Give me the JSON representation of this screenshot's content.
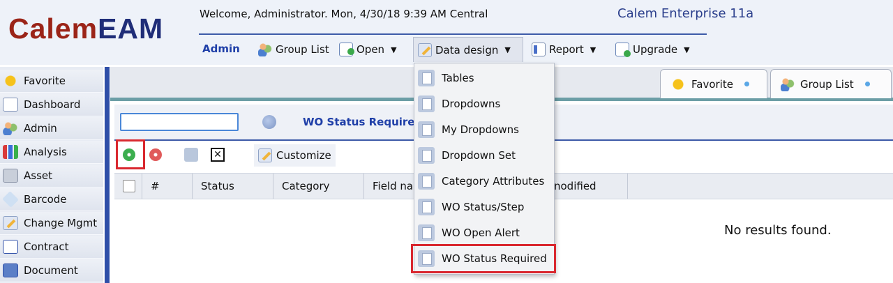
{
  "header": {
    "logo_part1": "Calem",
    "logo_part2": "EAM",
    "welcome": "Welcome, Administrator. Mon, 4/30/18 9:39 AM Central",
    "product": "Calem Enterprise 11a",
    "admin_link": "Admin",
    "menu": [
      {
        "label": "Group List",
        "icon": "users-icon",
        "caret": false
      },
      {
        "label": "Open",
        "icon": "open-icon",
        "caret": true
      },
      {
        "label": "Data design",
        "icon": "pencil-icon",
        "caret": true
      },
      {
        "label": "Report",
        "icon": "report-icon",
        "caret": true
      },
      {
        "label": "Upgrade",
        "icon": "upgrade-icon",
        "caret": true
      }
    ]
  },
  "sidebar": {
    "items": [
      {
        "label": "Favorite",
        "icon": "star-icon"
      },
      {
        "label": "Dashboard",
        "icon": "dashboard-icon"
      },
      {
        "label": "Admin",
        "icon": "users-icon"
      },
      {
        "label": "Analysis",
        "icon": "bar-chart-icon"
      },
      {
        "label": "Asset",
        "icon": "building-icon"
      },
      {
        "label": "Barcode",
        "icon": "tag-icon"
      },
      {
        "label": "Change Mgmt",
        "icon": "pencil-icon"
      },
      {
        "label": "Contract",
        "icon": "contract-icon"
      },
      {
        "label": "Document",
        "icon": "document-icon"
      }
    ]
  },
  "tabs": [
    {
      "label": "Favorite",
      "icon": "star-icon"
    },
    {
      "label": "Group List",
      "icon": "users-icon"
    }
  ],
  "panel": {
    "title": "WO Status Required",
    "search_value": "",
    "customize_label": "Customize",
    "columns": [
      "#",
      "Status",
      "Category",
      "Field na",
      "nodified"
    ],
    "no_results": "No results found."
  },
  "dropdown": {
    "items": [
      "Tables",
      "Dropdowns",
      "My Dropdowns",
      "Dropdown Set",
      "Category Attributes",
      "WO Status/Step",
      "WO Open Alert",
      "WO Status Required"
    ],
    "highlighted": "WO Status Required"
  },
  "colors": {
    "accent_blue": "#1f3fa8",
    "highlight_red": "#d9282f",
    "logo_red": "#9b2418",
    "logo_navy": "#1f2d78"
  }
}
